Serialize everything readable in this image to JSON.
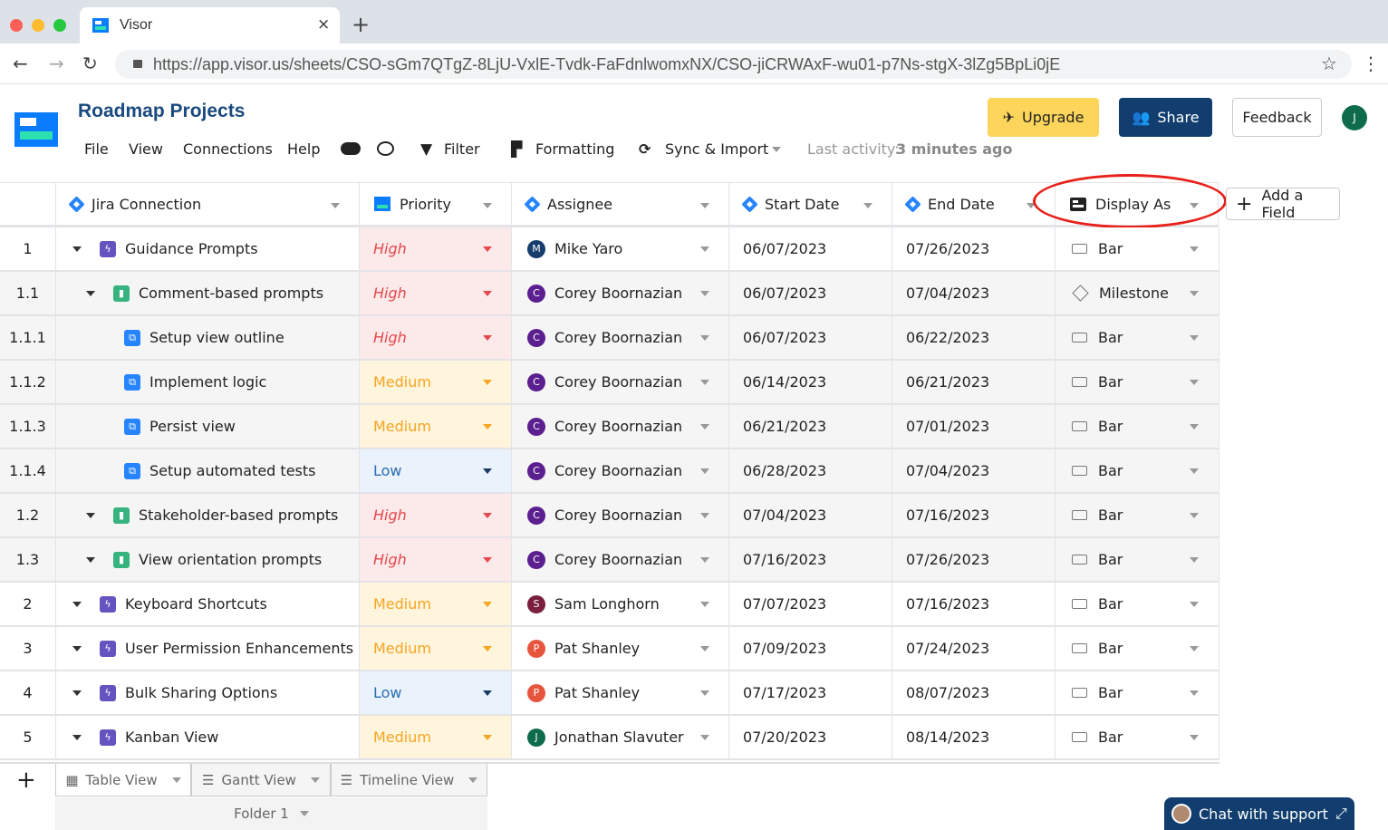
{
  "browser": {
    "tab_title": "Visor",
    "url": "https://app.visor.us/sheets/CSO-sGm7QTgZ-8LjU-VxlE-Tvdk-FaFdnlwomxNX/CSO-jiCRWAxF-wu01-p7Ns-stgX-3lZg5BpLi0jE"
  },
  "header": {
    "title": "Roadmap Projects",
    "menu": [
      "File",
      "View",
      "Connections",
      "Help"
    ],
    "filter": "Filter",
    "formatting": "Formatting",
    "sync": "Sync & Import",
    "last_activity_label": "Last activity:",
    "last_activity_value": "3 minutes ago",
    "upgrade": "Upgrade",
    "share": "Share",
    "feedback": "Feedback",
    "avatar": "J"
  },
  "columns": [
    "Jira Connection",
    "Priority",
    "Assignee",
    "Start Date",
    "End Date",
    "Display As"
  ],
  "add_field": "Add a Field",
  "priority_colors": {
    "High": {
      "bg": "#fce9e9",
      "fg": "#e5484d",
      "arrow": "#e5484d"
    },
    "Medium": {
      "bg": "#fff4dc",
      "fg": "#f5a623",
      "arrow": "#f5a623"
    },
    "Low": {
      "bg": "#eaf2fc",
      "fg": "#2b6cb0",
      "arrow": "#1a3a66"
    }
  },
  "rows": [
    {
      "num": "1",
      "level": 0,
      "type": "epic",
      "name": "Guidance Prompts",
      "priority": "High",
      "assignee": "Mike Yaro",
      "initial": "M",
      "avatar_color": "#163d6b",
      "start": "06/07/2023",
      "end": "07/26/2023",
      "display": "Bar"
    },
    {
      "num": "1.1",
      "level": 1,
      "type": "story",
      "name": "Comment-based prompts",
      "priority": "High",
      "assignee": "Corey Boornazian",
      "initial": "C",
      "avatar_color": "#5b1f8f",
      "start": "06/07/2023",
      "end": "07/04/2023",
      "display": "Milestone"
    },
    {
      "num": "1.1.1",
      "level": 2,
      "type": "subtask",
      "name": "Setup view outline",
      "priority": "High",
      "assignee": "Corey Boornazian",
      "initial": "C",
      "avatar_color": "#5b1f8f",
      "start": "06/07/2023",
      "end": "06/22/2023",
      "display": "Bar"
    },
    {
      "num": "1.1.2",
      "level": 2,
      "type": "subtask",
      "name": "Implement logic",
      "priority": "Medium",
      "assignee": "Corey Boornazian",
      "initial": "C",
      "avatar_color": "#5b1f8f",
      "start": "06/14/2023",
      "end": "06/21/2023",
      "display": "Bar"
    },
    {
      "num": "1.1.3",
      "level": 2,
      "type": "subtask",
      "name": "Persist view",
      "priority": "Medium",
      "assignee": "Corey Boornazian",
      "initial": "C",
      "avatar_color": "#5b1f8f",
      "start": "06/21/2023",
      "end": "07/01/2023",
      "display": "Bar"
    },
    {
      "num": "1.1.4",
      "level": 2,
      "type": "subtask",
      "name": "Setup automated tests",
      "priority": "Low",
      "assignee": "Corey Boornazian",
      "initial": "C",
      "avatar_color": "#5b1f8f",
      "start": "06/28/2023",
      "end": "07/04/2023",
      "display": "Bar"
    },
    {
      "num": "1.2",
      "level": 1,
      "type": "story",
      "name": "Stakeholder-based prompts",
      "priority": "High",
      "assignee": "Corey Boornazian",
      "initial": "C",
      "avatar_color": "#5b1f8f",
      "start": "07/04/2023",
      "end": "07/16/2023",
      "display": "Bar"
    },
    {
      "num": "1.3",
      "level": 1,
      "type": "story",
      "name": "View orientation  prompts",
      "priority": "High",
      "assignee": "Corey Boornazian",
      "initial": "C",
      "avatar_color": "#5b1f8f",
      "start": "07/16/2023",
      "end": "07/26/2023",
      "display": "Bar"
    },
    {
      "num": "2",
      "level": 0,
      "type": "epic",
      "name": "Keyboard Shortcuts",
      "priority": "Medium",
      "assignee": "Sam Longhorn",
      "initial": "S",
      "avatar_color": "#7a1f3d",
      "start": "07/07/2023",
      "end": "07/16/2023",
      "display": "Bar"
    },
    {
      "num": "3",
      "level": 0,
      "type": "epic",
      "name": "User Permission Enhancements",
      "priority": "Medium",
      "assignee": "Pat Shanley",
      "initial": "P",
      "avatar_color": "#e8553e",
      "start": "07/09/2023",
      "end": "07/24/2023",
      "display": "Bar"
    },
    {
      "num": "4",
      "level": 0,
      "type": "epic",
      "name": "Bulk Sharing Options",
      "priority": "Low",
      "assignee": "Pat Shanley",
      "initial": "P",
      "avatar_color": "#e8553e",
      "start": "07/17/2023",
      "end": "08/07/2023",
      "display": "Bar"
    },
    {
      "num": "5",
      "level": 0,
      "type": "epic",
      "name": "Kanban View",
      "priority": "Medium",
      "assignee": "Jonathan Slavuter",
      "initial": "J",
      "avatar_color": "#0e6b4b",
      "start": "07/20/2023",
      "end": "08/14/2023",
      "display": "Bar"
    }
  ],
  "views": [
    "Table View",
    "Gantt View",
    "Timeline View"
  ],
  "folder": "Folder 1",
  "chat": "Chat with support"
}
